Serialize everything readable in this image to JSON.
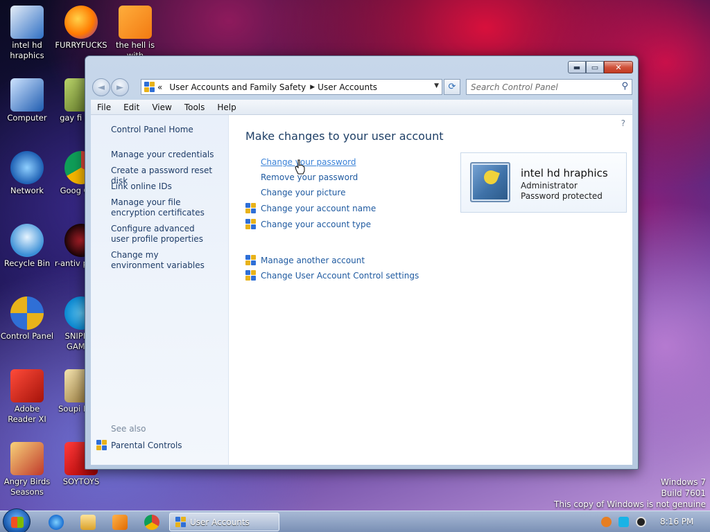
{
  "desktop": {
    "icons": [
      {
        "label": "intel hd hraphics"
      },
      {
        "label": "FURRYFUCKS"
      },
      {
        "label": "the hell is with"
      },
      {
        "label": "Computer"
      },
      {
        "label": "gay fi porn"
      },
      {
        "label": "Network"
      },
      {
        "label": "Goog Chro"
      },
      {
        "label": "Recycle Bin"
      },
      {
        "label": "r-antiv paracl"
      },
      {
        "label": "Control Panel"
      },
      {
        "label": "SNIPED! GAMER"
      },
      {
        "label": "Adobe Reader XI"
      },
      {
        "label": "Soupi Plays"
      },
      {
        "label": "Angry Birds Seasons"
      },
      {
        "label": "SOYTOYS"
      }
    ]
  },
  "window": {
    "caption_buttons": {
      "minimize": "▬",
      "maximize": "▭",
      "close": "✕"
    },
    "nav": {
      "back": "◄",
      "forward": "►"
    },
    "address": {
      "prefix": "«",
      "crumbs": [
        "User Accounts and Family Safety",
        "User Accounts"
      ]
    },
    "search": {
      "placeholder": "Search Control Panel"
    },
    "menu": [
      "File",
      "Edit",
      "View",
      "Tools",
      "Help"
    ],
    "left_pane": {
      "home": "Control Panel Home",
      "links": [
        "Manage your credentials",
        "Create a password reset disk",
        "Link online IDs",
        "Manage your file encryption certificates",
        "Configure advanced user profile properties",
        "Change my environment variables"
      ],
      "see_also_label": "See also",
      "see_also": [
        "Parental Controls"
      ]
    },
    "main": {
      "title": "Make changes to your user account",
      "tasks": [
        "Change your password",
        "Remove your password",
        "Change your picture",
        "Change your account name",
        "Change your account type"
      ],
      "other_tasks": [
        "Manage another account",
        "Change User Account Control settings"
      ]
    },
    "account": {
      "name": "intel hd hraphics",
      "role": "Administrator",
      "status": "Password protected"
    }
  },
  "watermark": {
    "line1": "Windows 7",
    "line2": "Build 7601",
    "line3": "This copy of Windows is not genuine"
  },
  "taskbar": {
    "active_task": "User Accounts",
    "clock": "8:16 PM"
  }
}
